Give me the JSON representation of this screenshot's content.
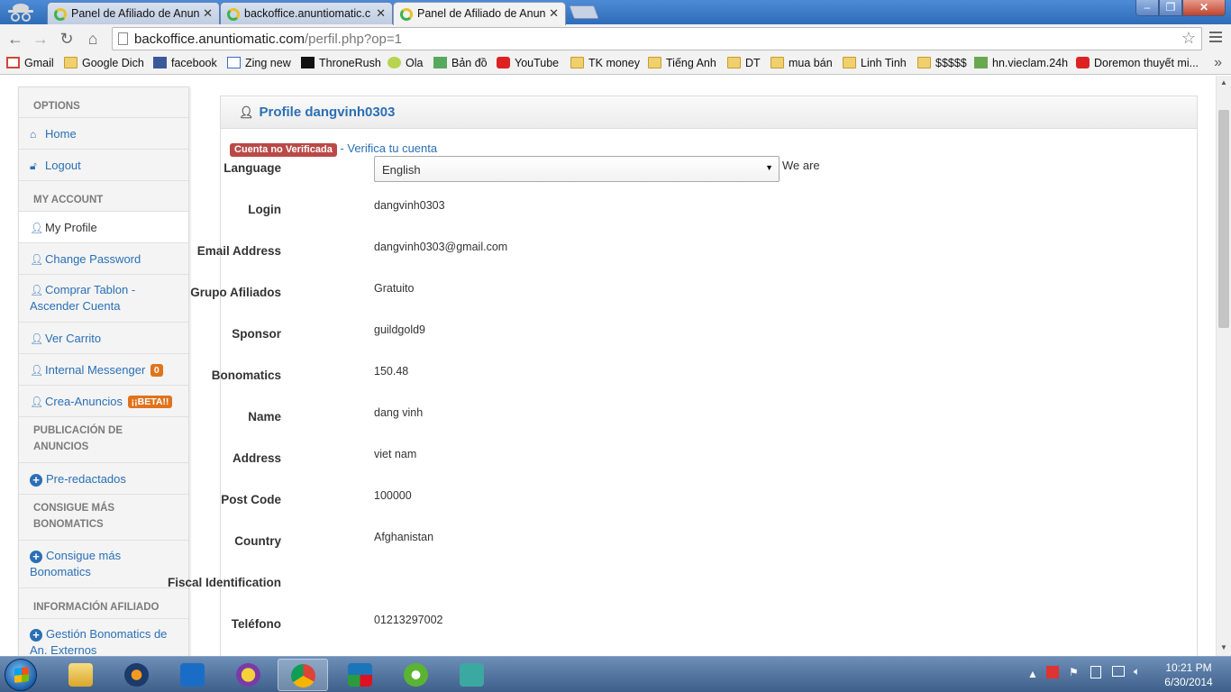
{
  "browser": {
    "tabs": [
      {
        "title": "Panel de Afiliado de Anun"
      },
      {
        "title": "backoffice.anuntiomatic.c"
      },
      {
        "title": "Panel de Afiliado de Anun",
        "active": true
      }
    ],
    "url_host": "backoffice.anuntiomatic.com",
    "url_path": "/perfil.php?op=1",
    "bookmarks": [
      {
        "label": "Gmail",
        "icon": "gmail-icon"
      },
      {
        "label": "Google Dich",
        "icon": "folder-icon"
      },
      {
        "label": "facebook",
        "icon": "facebook-icon"
      },
      {
        "label": "Zing new",
        "icon": "zing-icon"
      },
      {
        "label": "ThroneRush",
        "icon": "thronerush-icon"
      },
      {
        "label": "Ola",
        "icon": "ola-icon"
      },
      {
        "label": "Bản đồ",
        "icon": "map-icon"
      },
      {
        "label": "YouTube",
        "icon": "youtube-icon"
      },
      {
        "label": "TK money",
        "icon": "folder-icon"
      },
      {
        "label": "Tiếng Anh",
        "icon": "folder-icon"
      },
      {
        "label": "DT",
        "icon": "folder-icon"
      },
      {
        "label": "mua bán",
        "icon": "folder-icon"
      },
      {
        "label": "Linh Tinh",
        "icon": "folder-icon"
      },
      {
        "label": "$$$$$",
        "icon": "folder-icon"
      },
      {
        "label": "hn.vieclam.24h",
        "icon": "money-icon"
      },
      {
        "label": "Doremon thuyết mi...",
        "icon": "youtube-icon"
      }
    ]
  },
  "sidebar": {
    "options_header": "OPTIONS",
    "home": "Home",
    "logout": "Logout",
    "account_header": "MY ACCOUNT",
    "my_profile": "My Profile",
    "change_password": "Change Password",
    "comprar_tablon_1": "Comprar Tablon -",
    "comprar_tablon_2": "Ascender Cuenta",
    "ver_carrito": "Ver Carrito",
    "internal_messenger": "Internal Messenger",
    "messenger_count": "0",
    "crea_anuncios": "Crea-Anuncios",
    "beta_badge": "¡¡BETA!!",
    "publicacion_header_1": "PUBLICACIÓN DE",
    "publicacion_header_2": "ANUNCIOS",
    "pre_redactados": "Pre-redactados",
    "consigue_header_1": "CONSIGUE MÁS",
    "consigue_header_2": "BONOMATICS",
    "consigue_1": "Consigue más",
    "consigue_2": "Bonomatics",
    "informacion_header": "INFORMACIÓN AFILIADO",
    "gestion_1": "Gestión Bonomatics de",
    "gestion_2": "An. Externos"
  },
  "profile": {
    "title": "Profile dangvinh0303",
    "status_label": "Cuenta no Verificada",
    "verify_separator": " - ",
    "verify_link": "Verifica tu cuenta",
    "language_label": "Language",
    "language_value": "English",
    "we_are": "We are",
    "fields": [
      {
        "label": "Login",
        "value": "dangvinh0303"
      },
      {
        "label": "Email Address",
        "value": "dangvinh0303@gmail.com"
      },
      {
        "label": "Grupo Afiliados",
        "value": "Gratuito"
      },
      {
        "label": "Sponsor",
        "value": "guildgold9"
      },
      {
        "label": "Bonomatics",
        "value": "150.48"
      },
      {
        "label": "Name",
        "value": "dang vinh"
      },
      {
        "label": "Address",
        "value": "viet nam"
      },
      {
        "label": "Post Code",
        "value": "100000"
      },
      {
        "label": "Country",
        "value": "Afghanistan"
      },
      {
        "label": "Fiscal Identification",
        "value": ""
      },
      {
        "label": "Teléfono",
        "value": "01213297002"
      }
    ]
  },
  "taskbar": {
    "time": "10:21 PM",
    "date": "6/30/2014"
  }
}
